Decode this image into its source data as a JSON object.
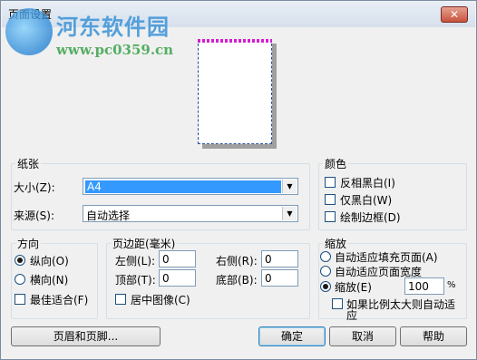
{
  "window": {
    "title": "页面设置",
    "close_glyph": "✕"
  },
  "watermark": {
    "site_name": "河东软件园",
    "url": "www.pc0359.cn"
  },
  "paper": {
    "legend": "纸张",
    "size_label": "大小(Z):",
    "size_value": "A4",
    "source_label": "来源(S):",
    "source_value": "自动选择"
  },
  "color": {
    "legend": "颜色",
    "invert_bw": "反相黑白(I)",
    "bw_only": "仅黑白(W)",
    "draw_border": "绘制边框(D)"
  },
  "orientation": {
    "legend": "方向",
    "portrait": "纵向(O)",
    "landscape": "横向(N)",
    "best_fit": "最佳适合(F)"
  },
  "margins": {
    "legend": "页边距(毫米)",
    "left_label": "左侧(L):",
    "left_value": "0",
    "right_label": "右侧(R):",
    "right_value": "0",
    "top_label": "顶部(T):",
    "top_value": "0",
    "bottom_label": "底部(B):",
    "bottom_value": "0",
    "center_image": "居中图像(C)"
  },
  "scaling": {
    "legend": "缩放",
    "fit_fill_page": "自动适应填充页面(A)",
    "fit_page_width": "自动适应页面宽度",
    "zoom_label": "缩放(E)",
    "zoom_value": "100",
    "zoom_unit": "%",
    "auto_fit_large_line1": "如果比例太大则自动适",
    "auto_fit_large_line2": "应"
  },
  "buttons": {
    "header_footer": "页眉和页脚...",
    "ok": "确定",
    "cancel": "取消",
    "help": "帮助"
  }
}
